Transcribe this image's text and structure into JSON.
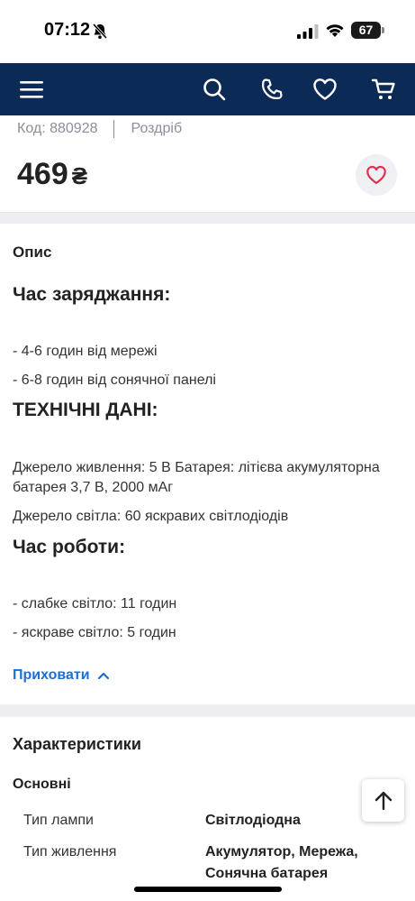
{
  "status_bar": {
    "time": "07:12",
    "battery": "67"
  },
  "nav": {
    "icons": [
      "menu-icon",
      "search-icon",
      "phone-icon",
      "heart-icon",
      "cart-icon"
    ],
    "background": "#0b2a55"
  },
  "product": {
    "code": "Код: 880928",
    "retail": "Роздріб",
    "price": "469",
    "currency": "₴"
  },
  "description": {
    "title": "Опис",
    "charging_heading": "Час заряджання:",
    "charging_items": [
      "- 4-6 годин від мережі",
      "- 6-8 годин від сонячної панелі"
    ],
    "tech_heading": "ТЕХНІЧНІ ДАНІ:",
    "tech_power": "Джерело живлення: 5 В Батарея: літієва акумуляторна батарея 3,7 В, 2000 мАг",
    "tech_light": "Джерело світла: 60 яскравих світлодіодів",
    "work_heading": "Час роботи:",
    "work_items": [
      "- слабке світло: 11 годин",
      "- яскраве світло: 5 годин"
    ],
    "hide_label": "Приховати"
  },
  "characteristics": {
    "title": "Характеристики",
    "group": "Основні",
    "rows": [
      {
        "label": "Тип лампи",
        "value": "Світлодіодна"
      },
      {
        "label": "Тип живлення",
        "value": "Акумулятор, Мережа, Сонячна батарея"
      }
    ]
  },
  "colors": {
    "accent": "#1b6fd6",
    "heart": "#e0314f"
  }
}
